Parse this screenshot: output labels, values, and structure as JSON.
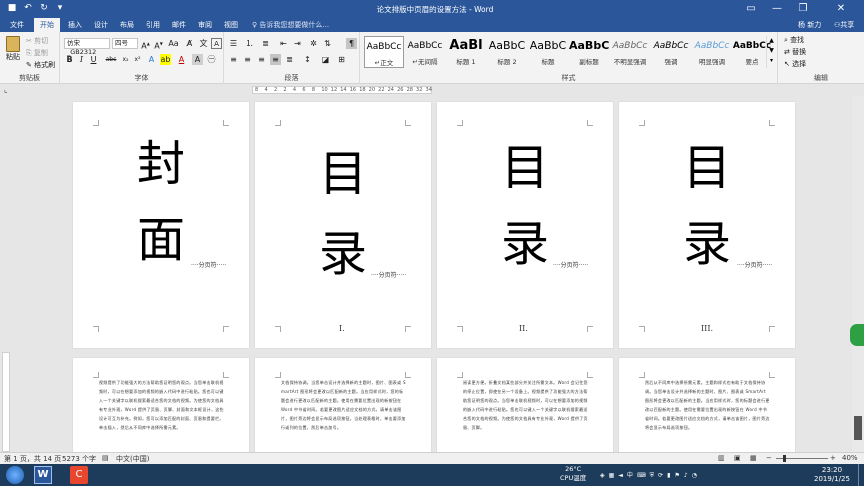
{
  "window": {
    "title": "论文排版中页眉的设置方法 - Word",
    "user": "杨 新力",
    "share": "共享"
  },
  "tabs": [
    "文件",
    "开始",
    "插入",
    "设计",
    "布局",
    "引用",
    "邮件",
    "审阅",
    "视图"
  ],
  "active_tab": "开始",
  "tell_me": "告诉我您想要做什么...",
  "clipboard": {
    "paste": "粘贴",
    "cut": "剪切",
    "copy": "复制",
    "format_painter": "格式刷",
    "label": "剪贴板"
  },
  "font": {
    "name": "仿宋_GB2312",
    "size": "四号",
    "label": "字体",
    "bold": "B",
    "italic": "I",
    "underline": "U",
    "strike": "abc",
    "sub": "x₂",
    "sup": "x²"
  },
  "paragraph": {
    "label": "段落"
  },
  "styles": {
    "label": "样式",
    "items": [
      {
        "preview": "AaBbCc",
        "name": "↵正文"
      },
      {
        "preview": "AaBbCc",
        "name": "↵无间隔"
      },
      {
        "preview": "AaBl",
        "name": "标题 1"
      },
      {
        "preview": "AaBbC",
        "name": "标题 2"
      },
      {
        "preview": "AaBbC",
        "name": "标题"
      },
      {
        "preview": "AaBbC",
        "name": "副标题"
      },
      {
        "preview": "AaBbCc",
        "name": "不明显强调"
      },
      {
        "preview": "AaBbCc",
        "name": "强调"
      },
      {
        "preview": "AaBbCc",
        "name": "明显强调"
      },
      {
        "preview": "AaBbCc",
        "name": "要点"
      }
    ]
  },
  "editing": {
    "find": "查找",
    "replace": "替换",
    "select": "选择",
    "label": "编辑"
  },
  "ruler": {
    "ticks": [
      "8",
      "4",
      "2",
      "2",
      "4",
      "6",
      "8",
      "10",
      "12",
      "14",
      "16",
      "18",
      "20",
      "22",
      "24",
      "26",
      "28",
      "32",
      "34"
    ]
  },
  "pages_top": [
    {
      "chars": [
        "封",
        "面"
      ],
      "break": "分页符",
      "number": ""
    },
    {
      "chars": [
        "目",
        "录"
      ],
      "break": "分页符",
      "number": "I."
    },
    {
      "chars": [
        "目",
        "录"
      ],
      "break": "分页符",
      "number": "II."
    },
    {
      "chars": [
        "目",
        "录"
      ],
      "break": "分页符",
      "number": "III."
    }
  ],
  "pages_bottom": [
    "视频提供了功能强大的方法帮助您证明您的观点。当您单击联机视频时，可以在想要添加的视频的嵌入代码中进行粘贴。您也可以键入一个关键字以联机搜索最适合您的文档的视频。为使您的文档具有专业外观，Word 提供了页眉、页脚、封面和文本框设计，这些设计可互为补充。例如，您可以添加匹配的封面、页眉和提要栏。单击插入，然后从不同库中选择所需元素。",
    "文档保持协调。当您单击设计并选择新的主题时，图片、图表或 SmartArt 图形将会更改以匹配新的主题。当应用样式时，您的标题会进行更改以匹配新的主题。使用在需要位置出现的新按钮在 Word 中节省时间。若要更改图片适应文档的方式，请单击该图片，图片旁边将会显示布局选项按钮。当处理表格时，单击要添加行或列的位置，然后单击加号。",
    "阅读更方便。折叠文档某些部分并关注所需文本。Word 会记住您的停止位置，即使在另一个设备上。视频提供了功能强大的方法帮助您证明您的观点。当您单击联机视频时，可以在想要添加的视频的嵌入代码中进行粘贴。您也可以键入一个关键字以联机搜索最适合您的文档的视频。为使您的文档具有专业外观，Word 提供了页眉、页脚。",
    "然后从不同库中选择所需元素。主题和样式也有助于文档保持协调。当您单击设计并选择新的主题时，图片、图表或 SmartArt 图形将会更改以匹配新的主题。当应用样式时，您的标题会进行更改以匹配新的主题。使用在需要位置出现的新按钮在 Word 中节省时间。若要更改图片适应文档的方式，请单击该图片，图片旁边将会显示布局选项按钮。"
  ],
  "status": {
    "page": "第 1 页，共 14 页",
    "words": "5273 个字",
    "lang": "中文(中国)",
    "zoom": "40%",
    "zoom_value": 40
  },
  "taskbar": {
    "temp": "26°C",
    "cpu": "CPU温度",
    "time": "23:20",
    "date": "2019/1/25"
  }
}
